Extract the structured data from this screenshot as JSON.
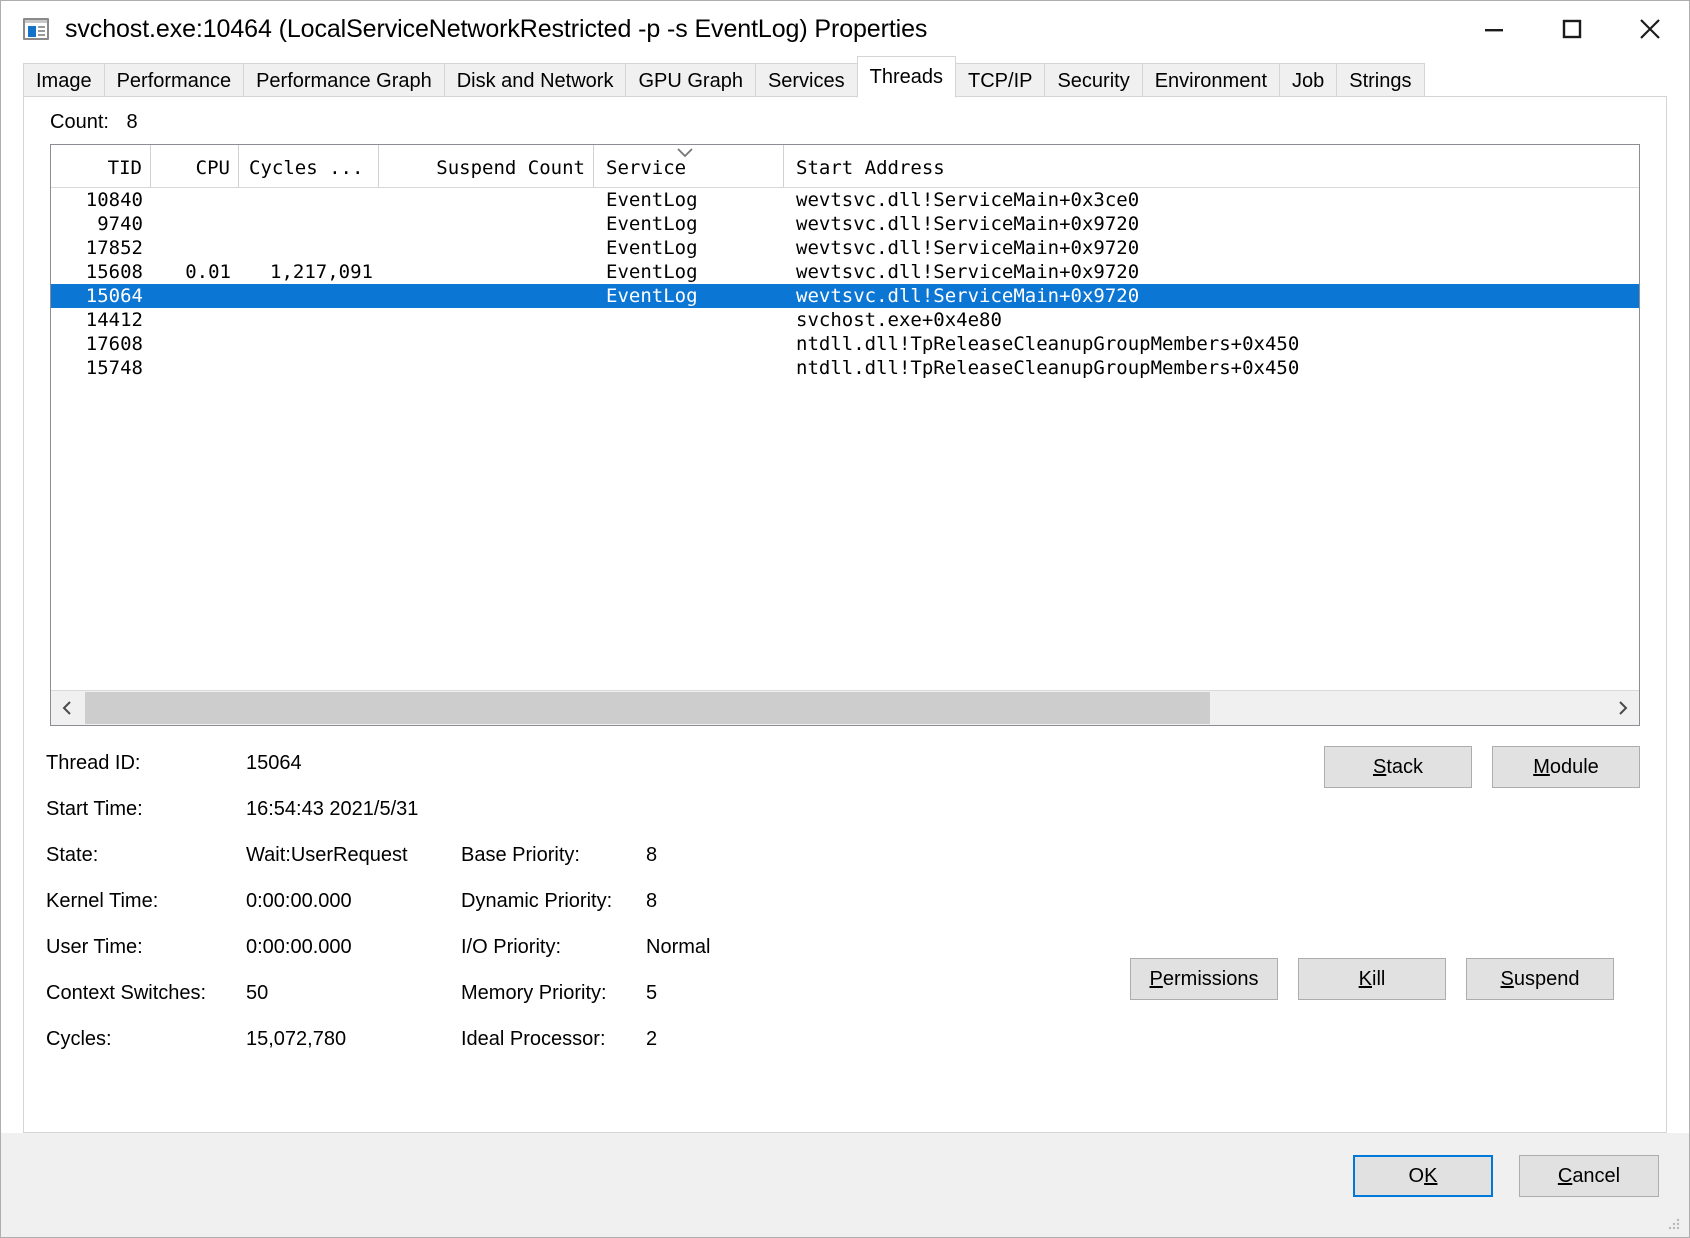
{
  "window": {
    "title": "svchost.exe:10464 (LocalServiceNetworkRestricted -p -s EventLog) Properties",
    "icon": "properties-window-icon",
    "controls": {
      "minimize": "minimize-icon",
      "maximize": "maximize-icon",
      "close": "close-icon"
    }
  },
  "tabs": [
    {
      "label": "Image",
      "active": false
    },
    {
      "label": "Performance",
      "active": false
    },
    {
      "label": "Performance Graph",
      "active": false
    },
    {
      "label": "Disk and Network",
      "active": false
    },
    {
      "label": "GPU Graph",
      "active": false
    },
    {
      "label": "Services",
      "active": false
    },
    {
      "label": "Threads",
      "active": true
    },
    {
      "label": "TCP/IP",
      "active": false
    },
    {
      "label": "Security",
      "active": false
    },
    {
      "label": "Environment",
      "active": false
    },
    {
      "label": "Job",
      "active": false
    },
    {
      "label": "Strings",
      "active": false
    }
  ],
  "count": {
    "label": "Count:",
    "value": "8"
  },
  "threads_list": {
    "columns": [
      {
        "key": "tid",
        "label": "TID"
      },
      {
        "key": "cpu",
        "label": "CPU"
      },
      {
        "key": "cycles",
        "label": "Cycles ..."
      },
      {
        "key": "suspend",
        "label": "Suspend Count"
      },
      {
        "key": "service",
        "label": "Service"
      },
      {
        "key": "address",
        "label": "Start Address"
      }
    ],
    "sorted_column": "Service",
    "sort_direction": "descending",
    "rows": [
      {
        "tid": "10840",
        "cpu": "",
        "cycles": "",
        "suspend": "",
        "service": "EventLog",
        "address": "wevtsvc.dll!ServiceMain+0x3ce0",
        "selected": false
      },
      {
        "tid": "9740",
        "cpu": "",
        "cycles": "",
        "suspend": "",
        "service": "EventLog",
        "address": "wevtsvc.dll!ServiceMain+0x9720",
        "selected": false
      },
      {
        "tid": "17852",
        "cpu": "",
        "cycles": "",
        "suspend": "",
        "service": "EventLog",
        "address": "wevtsvc.dll!ServiceMain+0x9720",
        "selected": false
      },
      {
        "tid": "15608",
        "cpu": "0.01",
        "cycles": "1,217,091",
        "suspend": "",
        "service": "EventLog",
        "address": "wevtsvc.dll!ServiceMain+0x9720",
        "selected": false
      },
      {
        "tid": "15064",
        "cpu": "",
        "cycles": "",
        "suspend": "",
        "service": "EventLog",
        "address": "wevtsvc.dll!ServiceMain+0x9720",
        "selected": true
      },
      {
        "tid": "14412",
        "cpu": "",
        "cycles": "",
        "suspend": "",
        "service": "",
        "address": "svchost.exe+0x4e80",
        "selected": false
      },
      {
        "tid": "17608",
        "cpu": "",
        "cycles": "",
        "suspend": "",
        "service": "",
        "address": "ntdll.dll!TpReleaseCleanupGroupMembers+0x450",
        "selected": false
      },
      {
        "tid": "15748",
        "cpu": "",
        "cycles": "",
        "suspend": "",
        "service": "",
        "address": "ntdll.dll!TpReleaseCleanupGroupMembers+0x450",
        "selected": false
      }
    ]
  },
  "scrollbar": {
    "left_arrow": "chevron-left-icon",
    "right_arrow": "chevron-right-icon",
    "thumb_fraction": 0.74
  },
  "details": {
    "thread_id": {
      "label": "Thread ID:",
      "value": "15064"
    },
    "start_time": {
      "label": "Start Time:",
      "value": "16:54:43  2021/5/31"
    },
    "state": {
      "label": "State:",
      "value": "Wait:UserRequest"
    },
    "kernel_time": {
      "label": "Kernel Time:",
      "value": "0:00:00.000"
    },
    "user_time": {
      "label": "User Time:",
      "value": "0:00:00.000"
    },
    "context_switches": {
      "label": "Context Switches:",
      "value": "50"
    },
    "cycles": {
      "label": "Cycles:",
      "value": "15,072,780"
    },
    "base_priority": {
      "label": "Base Priority:",
      "value": "8"
    },
    "dynamic_priority": {
      "label": "Dynamic Priority:",
      "value": "8"
    },
    "io_priority": {
      "label": "I/O Priority:",
      "value": "Normal"
    },
    "memory_priority": {
      "label": "Memory Priority:",
      "value": "5"
    },
    "ideal_processor": {
      "label": "Ideal Processor:",
      "value": "2"
    }
  },
  "buttons": {
    "stack": {
      "accel": "S",
      "rest": "tack"
    },
    "module": {
      "accel": "M",
      "rest": "odule"
    },
    "permissions": {
      "accel": "P",
      "rest": "ermissions"
    },
    "kill": {
      "accel": "K",
      "rest": "ill"
    },
    "suspend": {
      "accel": "S",
      "rest": "uspend"
    },
    "ok": {
      "pre": "O",
      "accel": "K",
      "rest": ""
    },
    "cancel": {
      "accel": "C",
      "rest": "ancel"
    }
  },
  "colors": {
    "selection": "#0b76d4",
    "default_button_focus": "#0078d7",
    "tab_inactive": "#f0f0f0",
    "footer": "#f0f0f0",
    "scroll_thumb": "#cdcdcd"
  }
}
